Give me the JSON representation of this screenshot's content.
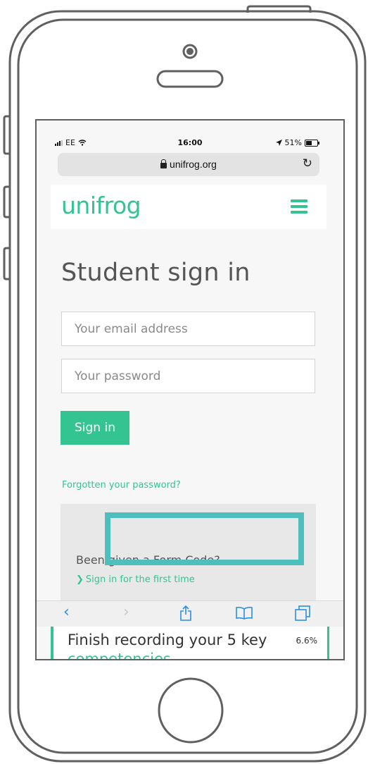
{
  "status_bar": {
    "carrier": "EE",
    "time": "16:00",
    "battery": "51%",
    "battery_level": 0.51
  },
  "browser": {
    "url": "unifrog.org"
  },
  "site": {
    "logo": "unifrog"
  },
  "page": {
    "title": "Student sign in",
    "email_placeholder": "Your email address",
    "password_placeholder": "Your password",
    "sign_in_label": "Sign in",
    "forgot_link": "Forgotten your password?"
  },
  "form_code": {
    "question": "Been given a Form Code?",
    "link_label": "Sign in for the first time"
  },
  "task_card": {
    "text": "Finish recording your 5 key",
    "percent": "6.6%",
    "continued": "competencies"
  },
  "colors": {
    "brand": "#34c491",
    "highlight": "#4fbfbe",
    "ios_blue": "#2a8ee8"
  },
  "icons": [
    "signal-icon",
    "wifi-icon",
    "location-arrow-icon",
    "battery-icon",
    "lock-icon",
    "reload-icon",
    "hamburger-menu-icon",
    "chevron-right-icon",
    "back-icon",
    "forward-icon",
    "share-icon",
    "bookmarks-icon",
    "tabs-icon"
  ]
}
